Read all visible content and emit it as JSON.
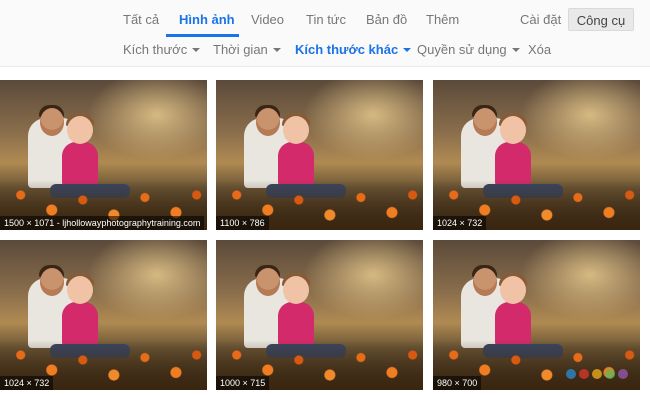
{
  "nav": {
    "tabs": [
      {
        "label": "Tất cả"
      },
      {
        "label": "Hình ảnh"
      },
      {
        "label": "Video"
      },
      {
        "label": "Tin tức"
      },
      {
        "label": "Bản đồ"
      },
      {
        "label": "Thêm"
      }
    ],
    "active_tab": "Hình ảnh",
    "settings_label": "Cài đặt",
    "tools_label": "Công cụ"
  },
  "filters": [
    {
      "label": "Kích thước"
    },
    {
      "label": "Thời gian"
    },
    {
      "label": "Kích thước khác"
    },
    {
      "label": "Quyền sử dụng"
    },
    {
      "label": "Xóa"
    }
  ],
  "active_filter": "Kích thước khác",
  "results": [
    {
      "caption": "1500 × 1071 - ljhollowayphotographytraining.com"
    },
    {
      "caption": "1100 × 786"
    },
    {
      "caption": "1024 × 732"
    },
    {
      "caption": "1024 × 732"
    },
    {
      "caption": "1000 × 715"
    },
    {
      "caption": "980 × 700"
    }
  ],
  "colors": {
    "accent": "#1a73e8",
    "text_muted": "#777777"
  }
}
